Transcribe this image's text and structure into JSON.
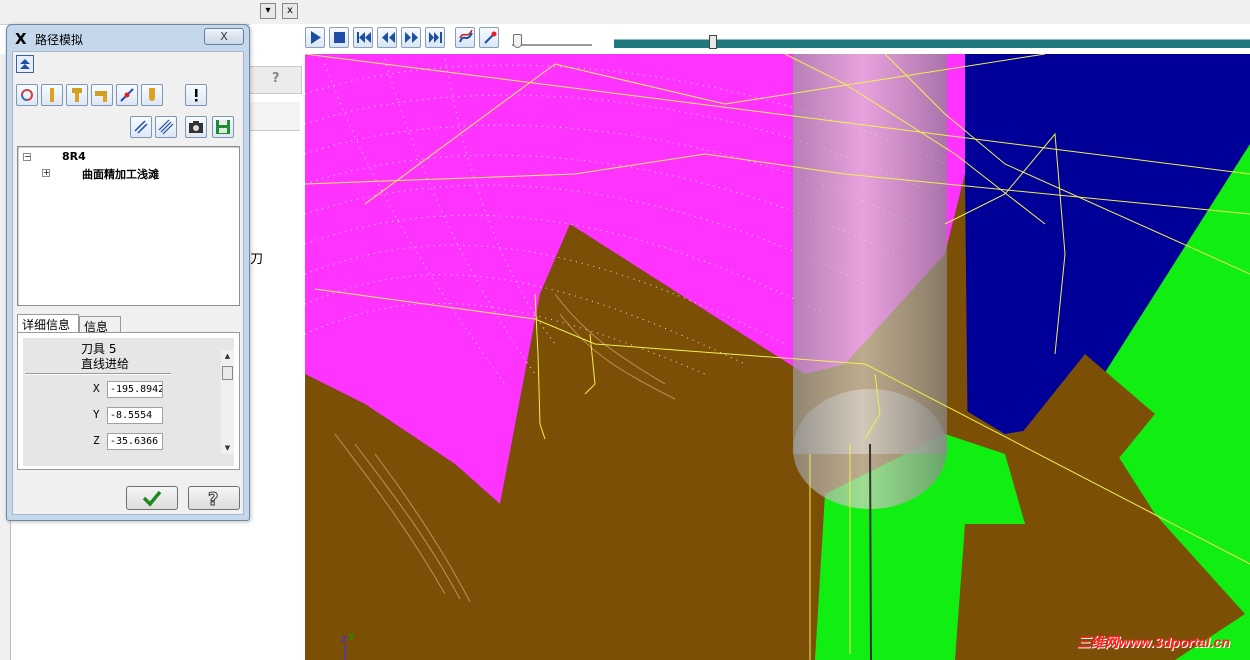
{
  "dialog": {
    "title": "路径模拟",
    "close_label": "X",
    "tree": {
      "root": "8R4",
      "child": "曲面精加工浅滩"
    },
    "tabs": [
      "详细信息",
      "信息"
    ],
    "details": {
      "tool_name": "刀具 5",
      "move_type": "直线进给",
      "coords": [
        {
          "label": "X",
          "value": "-195.8942"
        },
        {
          "label": "Y",
          "value": "-8.5554"
        },
        {
          "label": "Z",
          "value": "-35.6366"
        }
      ]
    }
  },
  "background_panel": {
    "partial_text": "刀"
  },
  "viewport": {
    "axis_z": "z",
    "axis_y": "y",
    "watermark": "三维网www.3dportal.cn"
  },
  "colors": {
    "magenta_surface": "#ff33ff",
    "brown_surface": "#7b4f06",
    "green_surface": "#11ee11",
    "blue_background": "#000099",
    "toolpath_yellow": "#f0f050",
    "progress_teal": "#22787f"
  },
  "icons": {
    "play": "play-icon",
    "stop": "stop-icon",
    "go_start": "go-start-icon",
    "step_back": "step-back-icon",
    "step_forward": "step-forward-icon",
    "go_end": "go-end-icon",
    "confirm": "checkmark-icon",
    "help": "question-icon"
  }
}
